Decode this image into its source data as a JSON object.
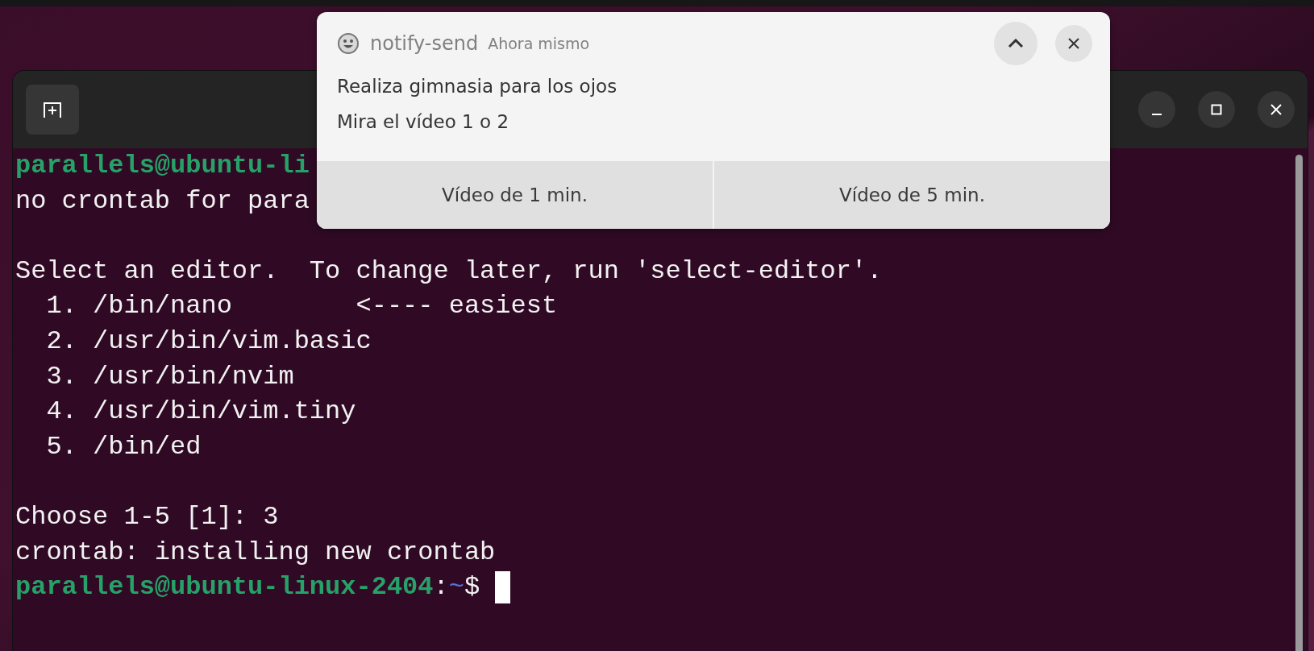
{
  "notification": {
    "app": "notify-send",
    "time": "Ahora mismo",
    "body": [
      "Realiza gimnasia para los ojos",
      "Mira el vídeo 1 o 2"
    ],
    "actions": [
      "Vídeo de 1 min.",
      "Vídeo de 5 min."
    ]
  },
  "terminal": {
    "lines": [
      {
        "segments": [
          {
            "kind": "host",
            "text": "parallels@ubuntu-li"
          }
        ]
      },
      {
        "segments": [
          {
            "kind": "plain",
            "text": "no crontab for para"
          }
        ]
      },
      {
        "blank_before": true,
        "segments": [
          {
            "kind": "plain",
            "text": "Select an editor.  To change later, run 'select-editor'."
          }
        ]
      },
      {
        "segments": [
          {
            "kind": "plain",
            "text": "  1. /bin/nano        <---- easiest"
          }
        ]
      },
      {
        "segments": [
          {
            "kind": "plain",
            "text": "  2. /usr/bin/vim.basic"
          }
        ]
      },
      {
        "segments": [
          {
            "kind": "plain",
            "text": "  3. /usr/bin/nvim"
          }
        ]
      },
      {
        "segments": [
          {
            "kind": "plain",
            "text": "  4. /usr/bin/vim.tiny"
          }
        ]
      },
      {
        "segments": [
          {
            "kind": "plain",
            "text": "  5. /bin/ed"
          }
        ]
      },
      {
        "blank_before": true,
        "segments": [
          {
            "kind": "plain",
            "text": "Choose 1-5 [1]: 3"
          }
        ]
      },
      {
        "segments": [
          {
            "kind": "plain",
            "text": "crontab: installing new crontab"
          }
        ]
      },
      {
        "segments": [
          {
            "kind": "host",
            "text": "parallels@ubuntu-linux-2404"
          },
          {
            "kind": "plain",
            "text": ":"
          },
          {
            "kind": "path",
            "text": "~"
          },
          {
            "kind": "plain",
            "text": "$"
          }
        ],
        "cursor": true
      }
    ]
  }
}
